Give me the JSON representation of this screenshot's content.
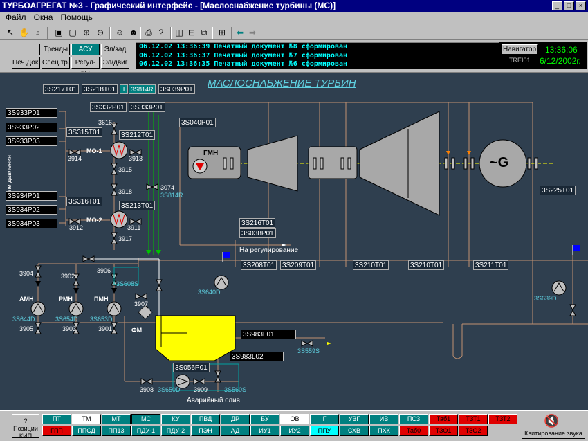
{
  "window": {
    "title": "ТУРБОАГРЕГАТ №3 - Графический интерфейс - [Маслоснабжение турбины (МС)]"
  },
  "menu": {
    "items": [
      "Файл",
      "Окна",
      "Помощь"
    ]
  },
  "controls": {
    "row1": [
      "",
      "Тренды",
      "АСУ",
      "Эл/зад"
    ],
    "row2": [
      "Печ.Док.",
      "Спец.тр.",
      "Регул-ры",
      "Эл/двиг"
    ]
  },
  "log": [
    "06.12.02 13:36:39  Печатный документ №8 сформирован",
    "06.12.02 13:36:37  Печатный документ №7 сформирован",
    "06.12.02 13:36:35  Печатный документ №6 сформирован"
  ],
  "nav": {
    "button": "Навигатор",
    "host": "TREI01",
    "time": "13:36:06",
    "date": "6/12/2002г."
  },
  "schema": {
    "title": "МАСЛОСНАБЖЕНИЕ  ТУРБИН",
    "relay_label": "Реле давления",
    "tags_top": [
      "3S217T01",
      "3S218T01",
      "T",
      "3S814R",
      "3S039P01"
    ],
    "pressure": [
      "3S933P01",
      "3S933P02",
      "3S933P03",
      "3S934P01",
      "3S934P02",
      "3S934P03"
    ],
    "tags": {
      "t332": "3S332P01",
      "t333": "3S333P01",
      "t315": "3S315T01",
      "t212": "3S212T01",
      "t316": "3S316T01",
      "t213": "3S213T01",
      "t040": "3S040P01",
      "t216": "3S216T01",
      "t038": "3S038P01",
      "t208": "3S208T01",
      "t209": "3S209T01",
      "t210a": "3S210T01",
      "t210b": "3S210T01",
      "t211": "3S211T01",
      "t225": "3S225T01",
      "l01": "3S983L01",
      "l02": "3S983L02",
      "p056": "3S056P01"
    },
    "labels": {
      "mo1": "МО-1",
      "mo2": "МО-2",
      "gmn": "ГМН",
      "gen": "~G",
      "amn": "АМН",
      "rmn": "РМН",
      "pmn": "ПМН",
      "fm": "ФМ",
      "reg": "На регулирование",
      "drain": "Аварийный слив",
      "v3616": "3616",
      "v3914": "3914",
      "v3913": "3913",
      "v3915": "3915",
      "v3918": "3918",
      "v3074": "3074",
      "s814": "3S814R",
      "v3912": "3912",
      "v3911": "3911",
      "v3917": "3917",
      "v3904": "3904",
      "v3902": "3902",
      "v3906": "3906",
      "v3903": "3903",
      "v3901": "3901",
      "v3907": "3907",
      "v3905": "3905",
      "v3908": "3908",
      "v3909": "3909",
      "s608": "3S608S",
      "s640": "3S640D",
      "s644": "3S644D",
      "s654": "3S654D",
      "s653": "3S653D",
      "s559": "3S559S",
      "s650": "3S650D",
      "s560": "3S560S",
      "s639": "3S639D"
    }
  },
  "bottom": {
    "pos_label": "? Позиции КИП",
    "row1": [
      "ПТ",
      "ТМ",
      "МТ",
      "МС",
      "КУ",
      "ПВД",
      "ДР",
      "БУ",
      "ОВ",
      "Г",
      "УВГ",
      "ИВ",
      "ПСЗ",
      "Таб1",
      "ТЗТ1",
      "ТЗТ2"
    ],
    "row2": [
      "ГПП",
      "ППСД",
      "ПП13",
      "ПДУ-1",
      "ПДУ-2",
      "ПЭН",
      "АД",
      "ИУ1",
      "ИУ2",
      "ППУ",
      "СХВ",
      "ПХК",
      "Таб0",
      "ТЗО1",
      "ТЗО2"
    ],
    "ack": "Квитирование звука"
  }
}
